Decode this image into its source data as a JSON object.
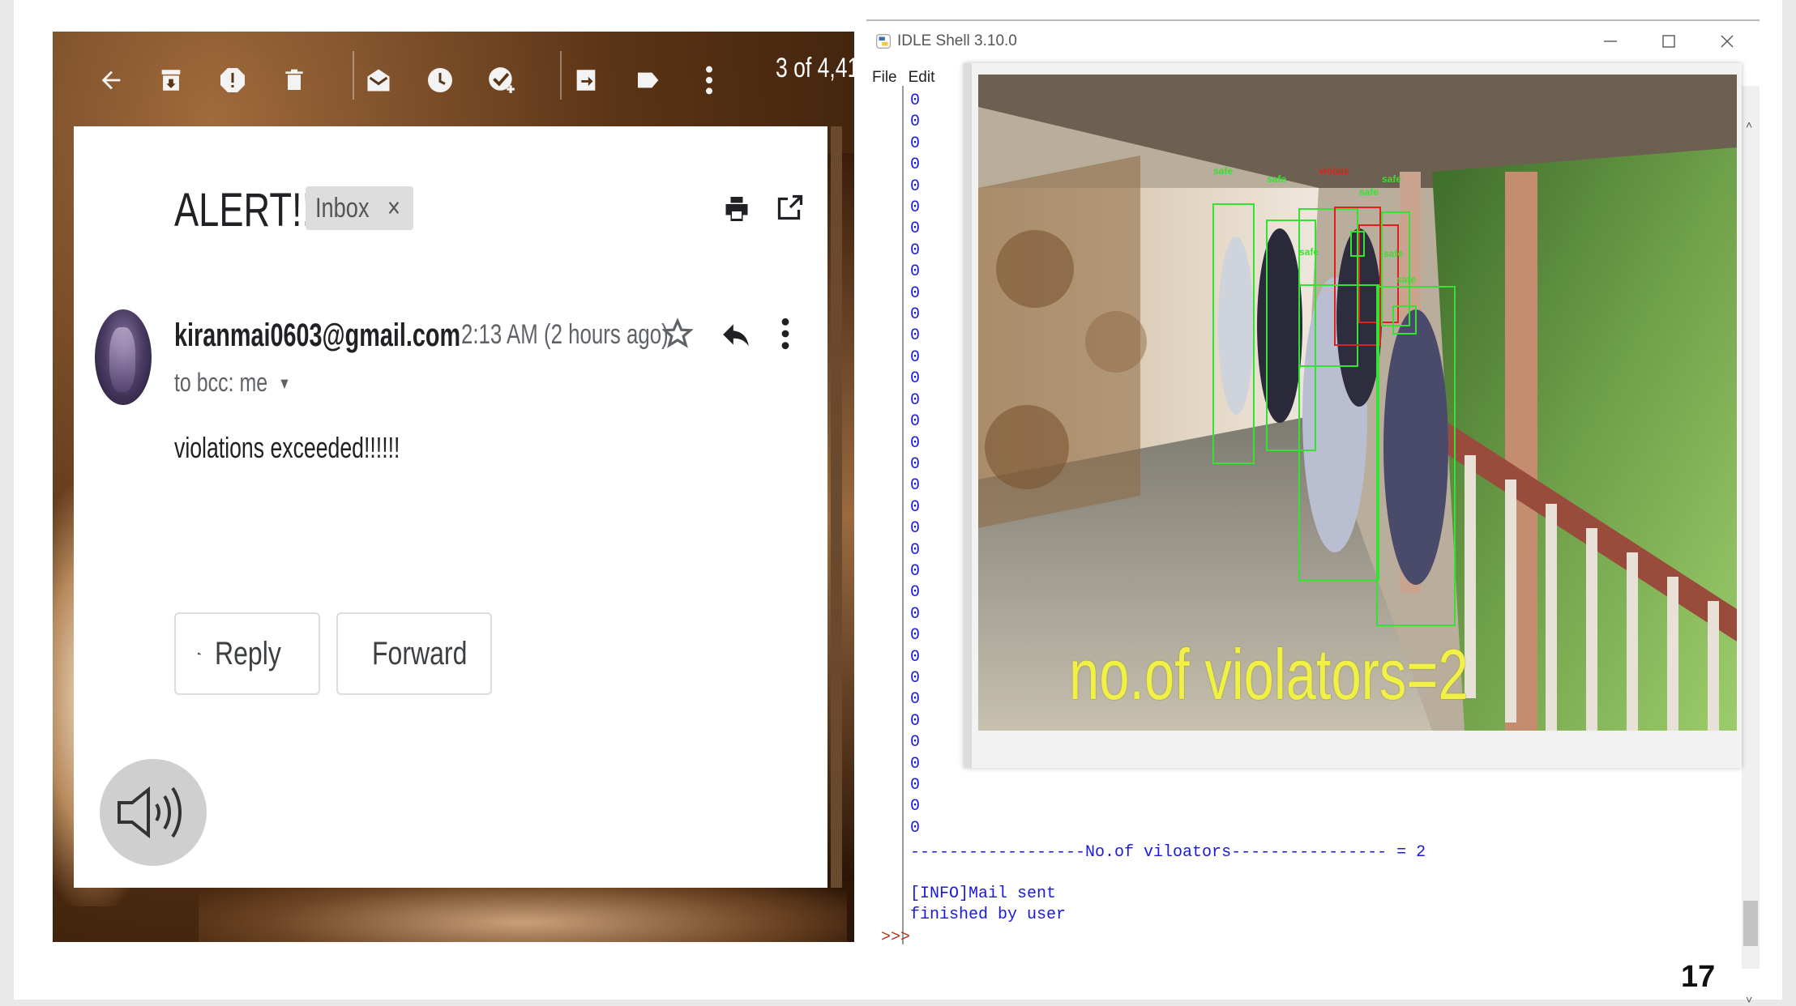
{
  "gmail": {
    "toolbar": {
      "icons": [
        "back-arrow-icon",
        "archive-icon",
        "report-spam-icon",
        "delete-icon",
        "mark-unread-icon",
        "snooze-icon",
        "add-to-tasks-icon",
        "move-to-icon",
        "label-icon",
        "more-vert-icon"
      ],
      "count": "3 of 4,41"
    },
    "subject": "ALERT!!!!",
    "label": "Inbox",
    "label_close": "×",
    "sender": "kiranmai0603@gmail.com",
    "recipients": "to bcc: me",
    "time": "2:13 AM (2 hours ago)",
    "body": "violations exceeded!!!!!!",
    "reply_label": "Reply",
    "forward_label": "Forward"
  },
  "idle": {
    "title": "IDLE Shell 3.10.0",
    "menu": [
      "File",
      "Edit"
    ],
    "output_lines": [
      "0",
      "0",
      "0",
      "0",
      "0",
      "0",
      "0",
      "0",
      "0",
      "0",
      "0",
      "0",
      "0",
      "0",
      "0",
      "0",
      "0",
      "0",
      "0",
      "0",
      "0",
      "0",
      "0",
      "0",
      "0",
      "0",
      "0",
      "0",
      "0",
      "0",
      "0",
      "0",
      "0",
      "0",
      "0",
      "0",
      "0",
      "0",
      "0",
      "0",
      "0",
      "0",
      "0",
      "0",
      "0",
      "0",
      "0",
      "0",
      "0",
      "0",
      "0",
      "0",
      "0",
      "0",
      "0",
      "0",
      "0",
      "0",
      "0",
      "0",
      "0",
      "0",
      "0",
      "0",
      "0",
      "0",
      "0",
      "0",
      "0",
      "0",
      "0",
      "0",
      "0",
      "0",
      "0",
      "0",
      "0",
      "0",
      "0",
      "0",
      "0",
      "0",
      "0",
      "0",
      "0",
      "0",
      "0",
      "0",
      "0",
      "0",
      "0",
      "0",
      "0",
      "0",
      "0",
      "0",
      "0",
      "0",
      "0",
      "0",
      "0",
      "0",
      "0",
      "0",
      "0",
      "0",
      "0",
      "0",
      "0",
      "0",
      "0",
      "0",
      "0",
      "0",
      "0",
      "0",
      "0",
      "0",
      "0",
      "0",
      "0",
      "0",
      "0",
      "0",
      "0",
      "0",
      "0",
      "0",
      "0",
      "0",
      "0",
      "0",
      "0",
      "0",
      "0",
      "0",
      "0",
      "0",
      "0",
      "0",
      "0",
      "0",
      "0",
      "0",
      "0",
      "0",
      "0",
      "0",
      "0",
      "0",
      "0",
      "0",
      "0",
      "0",
      "0",
      "0",
      "0",
      "0",
      "0",
      "0",
      "0",
      "0",
      "0",
      "0",
      "0",
      "0",
      "0",
      "0",
      "0",
      "0",
      "0",
      "0",
      "0",
      "0",
      "0",
      "0",
      "0",
      "0",
      "0",
      "0",
      "0",
      "0",
      "0",
      "0",
      "0",
      "0",
      "0",
      "0",
      "0",
      "0",
      "0",
      "0",
      "0",
      "0",
      "0",
      "0",
      "0",
      "0",
      "0",
      "0"
    ],
    "separator_line": "------------------No.of viloators---------------- = 2",
    "info_mail": "[INFO]Mail sent",
    "info_finished": "finished by user",
    "prompt": ">>>",
    "video": {
      "overlay_text": "no.of  violators=2",
      "tags": [
        "safe",
        "safe",
        "violate",
        "safe",
        "safe",
        "safe",
        "safe",
        "safe"
      ],
      "colors": {
        "safe": "#33e233",
        "violate": "#e02020",
        "overlay": "#f1f046"
      }
    }
  },
  "slide": {
    "page_number": "17"
  }
}
